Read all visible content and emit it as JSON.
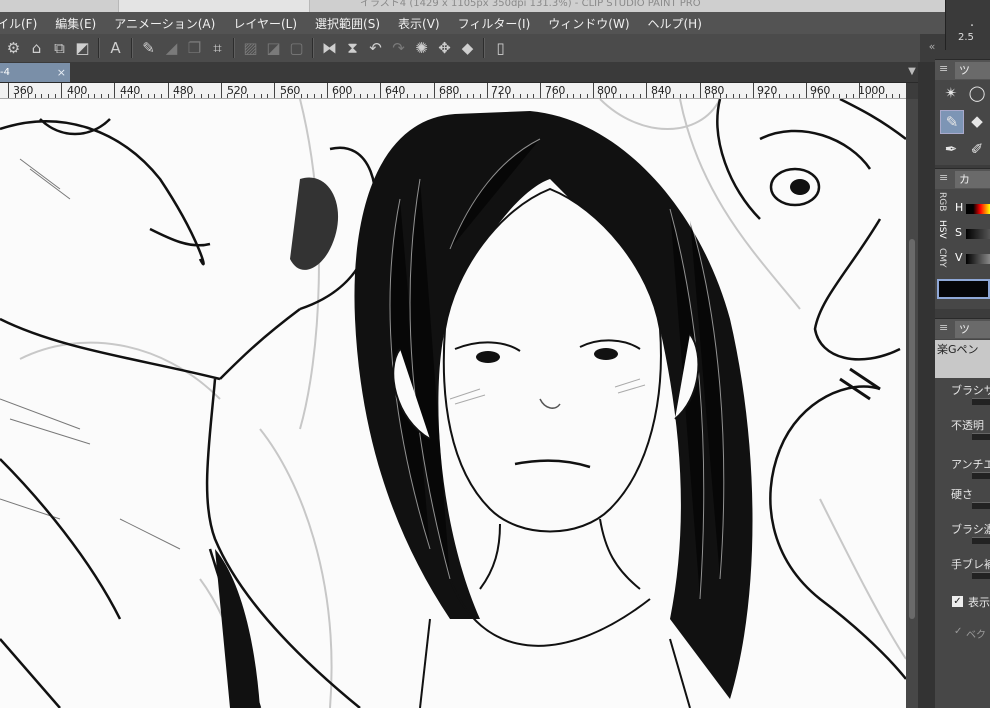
{
  "window": {
    "title": "イラスト4 (1429 x 1105px 350dpi 131.3%) - CLIP STUDIO PAINT PRO"
  },
  "menu": [
    "イル(F)",
    "編集(E)",
    "アニメーション(A)",
    "レイヤー(L)",
    "選択範囲(S)",
    "表示(V)",
    "フィルター(I)",
    "ウィンドウ(W)",
    "ヘルプ(H)"
  ],
  "zoom_box": {
    "dot": "・",
    "value": "2.5"
  },
  "toolbar": {
    "icons": [
      "wrench-icon",
      "clear-icon",
      "layer-fill-icon",
      "transform-icon",
      "text-icon",
      "settings-icon",
      "fill-gray-icon",
      "duplicate-icon",
      "crop-icon",
      "hatch1-icon",
      "hatch2-icon",
      "hatch3-icon",
      "flip-h-icon",
      "flip-v-icon",
      "undo-icon",
      "redo-icon",
      "loading-icon",
      "move-icon",
      "fill-bucket-icon",
      "device-icon"
    ],
    "collapse": "«"
  },
  "doc_tab": {
    "label": "-4",
    "close": "×"
  },
  "ruler": {
    "labels": [
      "360",
      "400",
      "440",
      "480",
      "520",
      "560",
      "600",
      "640",
      "680",
      "720",
      "760",
      "800",
      "840",
      "880",
      "920",
      "960",
      "1000"
    ]
  },
  "right_panel": {
    "tool_panel_tab": "ツ",
    "color_panel_tab": "カ",
    "color_modes": [
      "RGB",
      "HSV",
      "CMY"
    ],
    "color_channels": [
      "H",
      "S",
      "V"
    ],
    "brush_panel_tab": "ツ",
    "brush_name": "楽Gペン",
    "properties": [
      "ブラシサ",
      "不透明",
      "アンチエイ",
      "硬さ",
      "ブラシ濃",
      "手ブレ補"
    ],
    "checkbox_label": "表示",
    "check_label2": "ベク"
  }
}
